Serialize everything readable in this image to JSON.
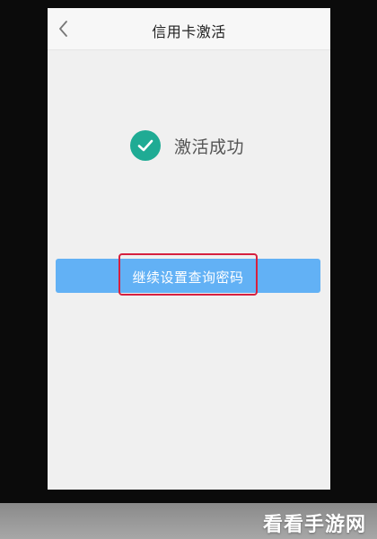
{
  "header": {
    "title": "信用卡激活",
    "back_icon": "chevron-left-icon"
  },
  "status": {
    "icon": "check-circle-icon",
    "text": "激活成功",
    "icon_color": "#1fab94"
  },
  "actions": {
    "continue_label": "继续设置查询密码",
    "button_color": "#62b1f5",
    "highlight_color": "#d6203f"
  },
  "watermark": {
    "text": "看看手游网"
  }
}
